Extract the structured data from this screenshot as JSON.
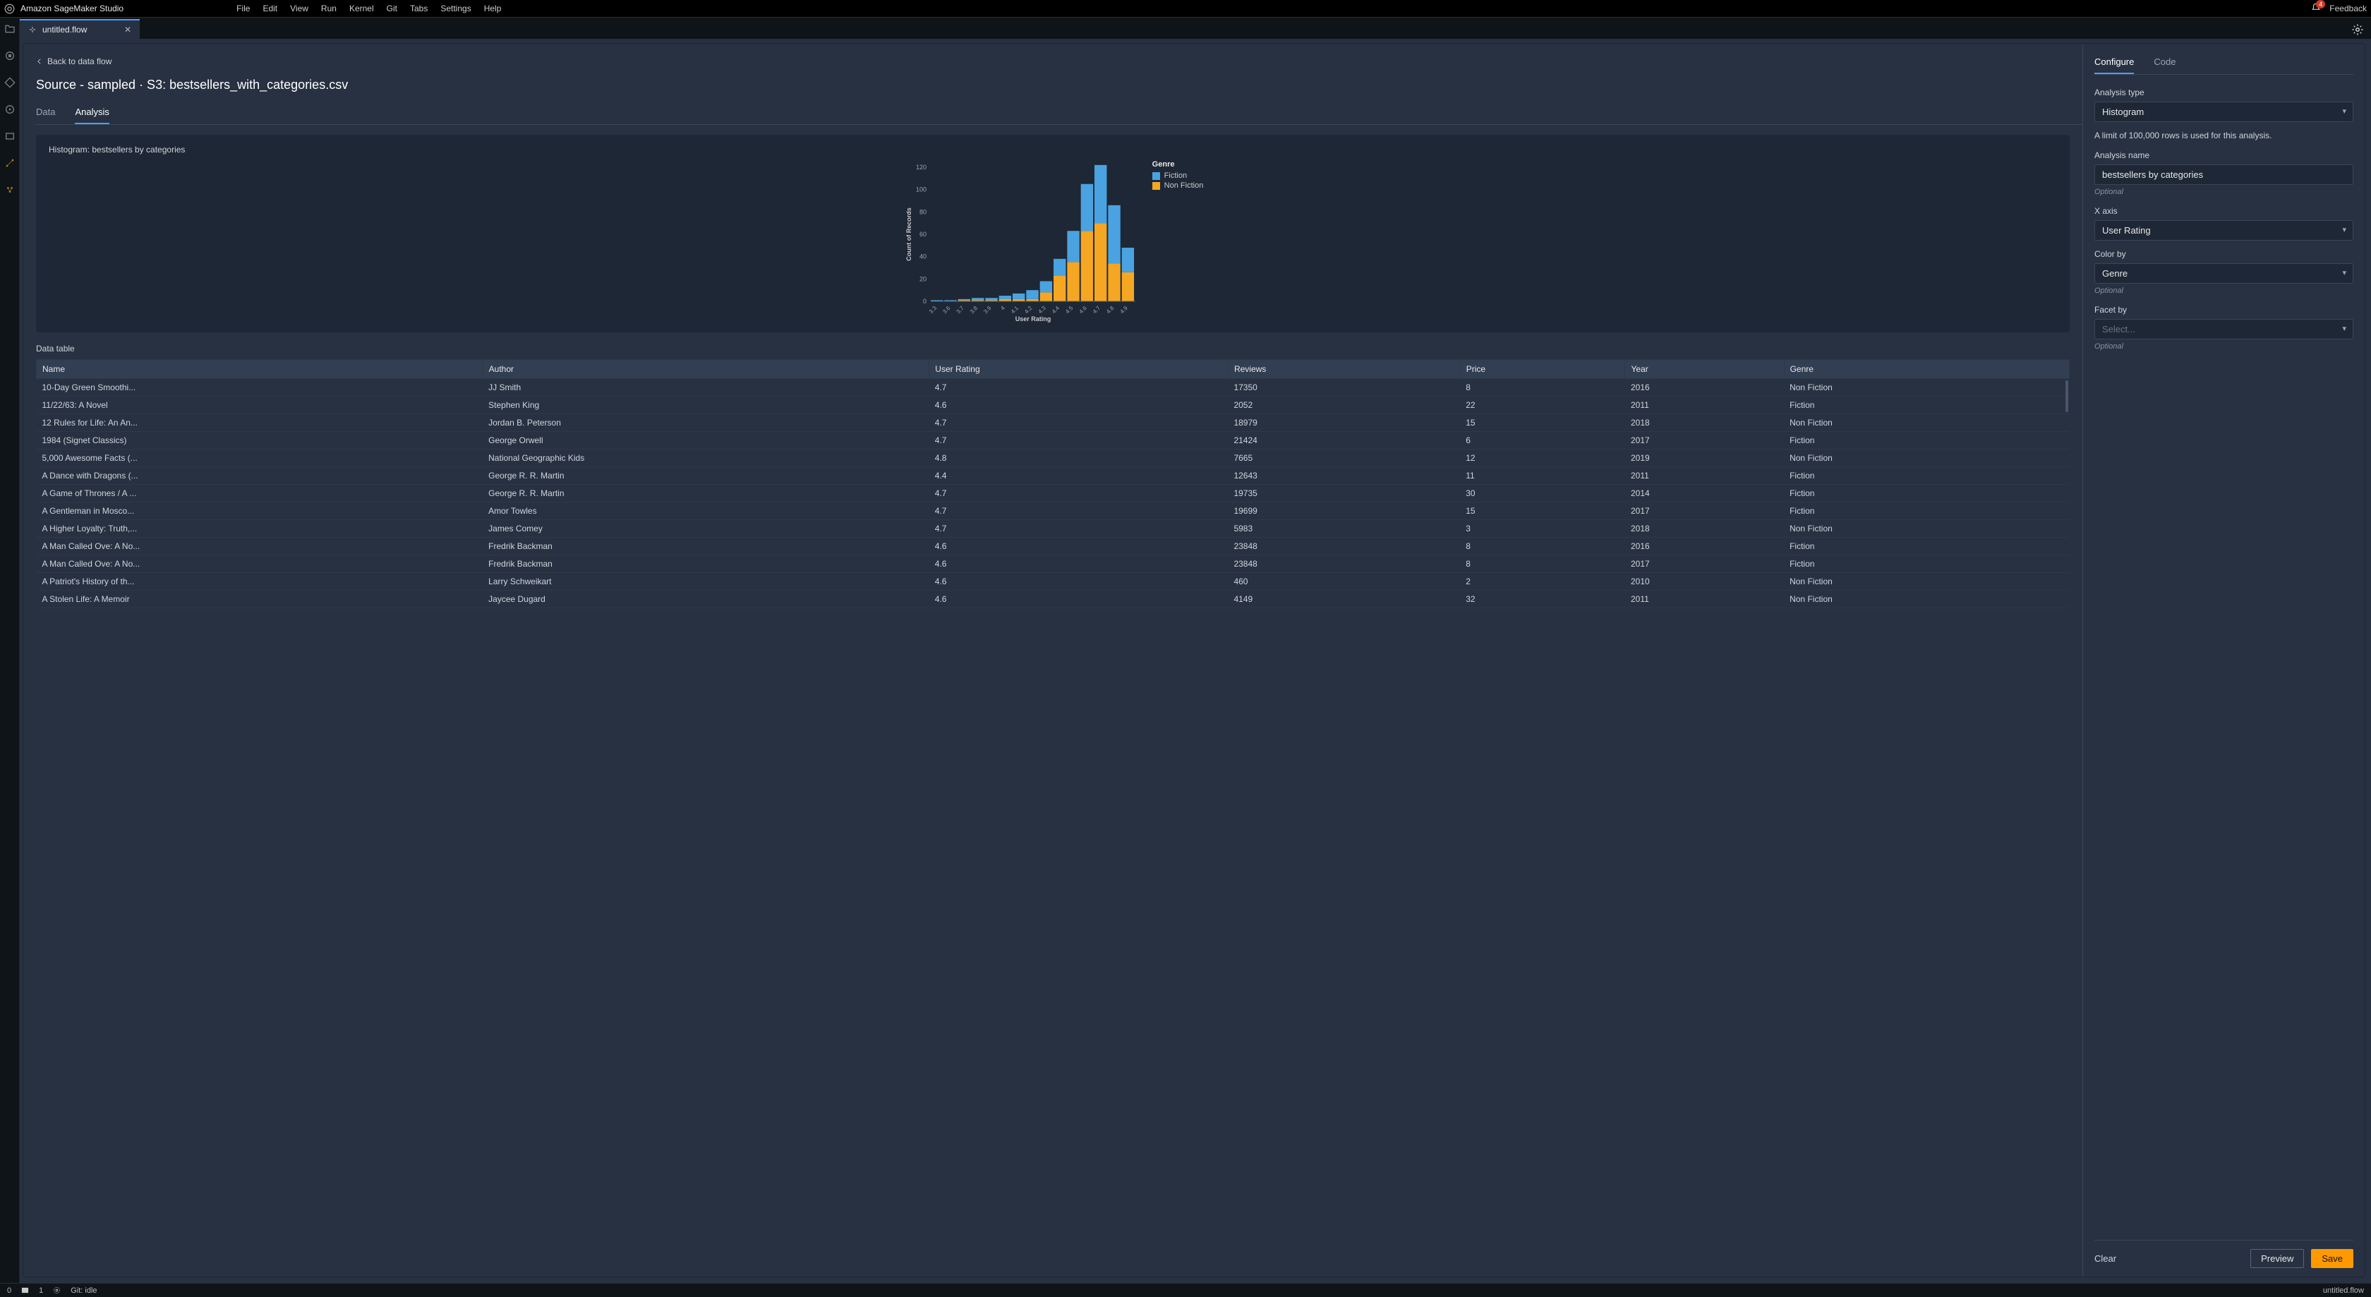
{
  "app": {
    "title": "Amazon SageMaker Studio"
  },
  "menu": [
    "File",
    "Edit",
    "View",
    "Run",
    "Kernel",
    "Git",
    "Tabs",
    "Settings",
    "Help"
  ],
  "notifications": {
    "count": "4"
  },
  "feedback_label": "Feedback",
  "tab": {
    "filename": "untitled.flow"
  },
  "back_link": "Back to data flow",
  "page_title": "Source - sampled · S3: bestsellers_with_categories.csv",
  "inner_tabs": {
    "data": "Data",
    "analysis": "Analysis"
  },
  "chart": {
    "title": "Histogram: bestsellers by categories"
  },
  "chart_data": {
    "type": "bar_stacked",
    "title": "Histogram: bestsellers by categories",
    "xlabel": "User Rating",
    "ylabel": "Count of Records",
    "ylim": [
      0,
      120
    ],
    "yticks": [
      0,
      20,
      40,
      60,
      80,
      100,
      120
    ],
    "categories": [
      "3.3",
      "3.6",
      "3.7",
      "3.8",
      "3.9",
      "4",
      "4.1",
      "4.2",
      "4.3",
      "4.4",
      "4.5",
      "4.6",
      "4.7",
      "4.8",
      "4.9"
    ],
    "legend_title": "Genre",
    "series": [
      {
        "name": "Fiction",
        "color": "#4aa3e0",
        "values": [
          1,
          1,
          1,
          2,
          2,
          3,
          5,
          8,
          10,
          15,
          28,
          42,
          52,
          52,
          22
        ]
      },
      {
        "name": "Non Fiction",
        "color": "#f5a623",
        "values": [
          0,
          0,
          1,
          1,
          1,
          2,
          2,
          2,
          8,
          23,
          35,
          63,
          70,
          34,
          26
        ]
      }
    ]
  },
  "data_table_label": "Data table",
  "table": {
    "columns": [
      "Name",
      "Author",
      "User Rating",
      "Reviews",
      "Price",
      "Year",
      "Genre"
    ],
    "rows": [
      [
        "10-Day Green Smoothi...",
        "JJ Smith",
        "4.7",
        "17350",
        "8",
        "2016",
        "Non Fiction"
      ],
      [
        "11/22/63: A Novel",
        "Stephen King",
        "4.6",
        "2052",
        "22",
        "2011",
        "Fiction"
      ],
      [
        "12 Rules for Life: An An...",
        "Jordan B. Peterson",
        "4.7",
        "18979",
        "15",
        "2018",
        "Non Fiction"
      ],
      [
        "1984 (Signet Classics)",
        "George Orwell",
        "4.7",
        "21424",
        "6",
        "2017",
        "Fiction"
      ],
      [
        "5,000 Awesome Facts (...",
        "National Geographic Kids",
        "4.8",
        "7665",
        "12",
        "2019",
        "Non Fiction"
      ],
      [
        "A Dance with Dragons (...",
        "George R. R. Martin",
        "4.4",
        "12643",
        "11",
        "2011",
        "Fiction"
      ],
      [
        "A Game of Thrones / A ...",
        "George R. R. Martin",
        "4.7",
        "19735",
        "30",
        "2014",
        "Fiction"
      ],
      [
        "A Gentleman in Mosco...",
        "Amor Towles",
        "4.7",
        "19699",
        "15",
        "2017",
        "Fiction"
      ],
      [
        "A Higher Loyalty: Truth,...",
        "James Comey",
        "4.7",
        "5983",
        "3",
        "2018",
        "Non Fiction"
      ],
      [
        "A Man Called Ove: A No...",
        "Fredrik Backman",
        "4.6",
        "23848",
        "8",
        "2016",
        "Fiction"
      ],
      [
        "A Man Called Ove: A No...",
        "Fredrik Backman",
        "4.6",
        "23848",
        "8",
        "2017",
        "Fiction"
      ],
      [
        "A Patriot's History of th...",
        "Larry Schweikart",
        "4.6",
        "460",
        "2",
        "2010",
        "Non Fiction"
      ],
      [
        "A Stolen Life: A Memoir",
        "Jaycee Dugard",
        "4.6",
        "4149",
        "32",
        "2011",
        "Non Fiction"
      ]
    ]
  },
  "config": {
    "tabs": {
      "configure": "Configure",
      "code": "Code"
    },
    "analysis_type_label": "Analysis type",
    "analysis_type_value": "Histogram",
    "limit_text": "A limit of 100,000 rows is used for this analysis.",
    "analysis_name_label": "Analysis name",
    "analysis_name_value": "bestsellers by categories",
    "optional": "Optional",
    "x_axis_label": "X axis",
    "x_axis_value": "User Rating",
    "color_by_label": "Color by",
    "color_by_value": "Genre",
    "facet_by_label": "Facet by",
    "facet_by_placeholder": "Select...",
    "clear": "Clear",
    "preview": "Preview",
    "save": "Save"
  },
  "status": {
    "left_num": "0",
    "terminal": "1",
    "git": "Git: idle",
    "filename": "untitled.flow"
  }
}
